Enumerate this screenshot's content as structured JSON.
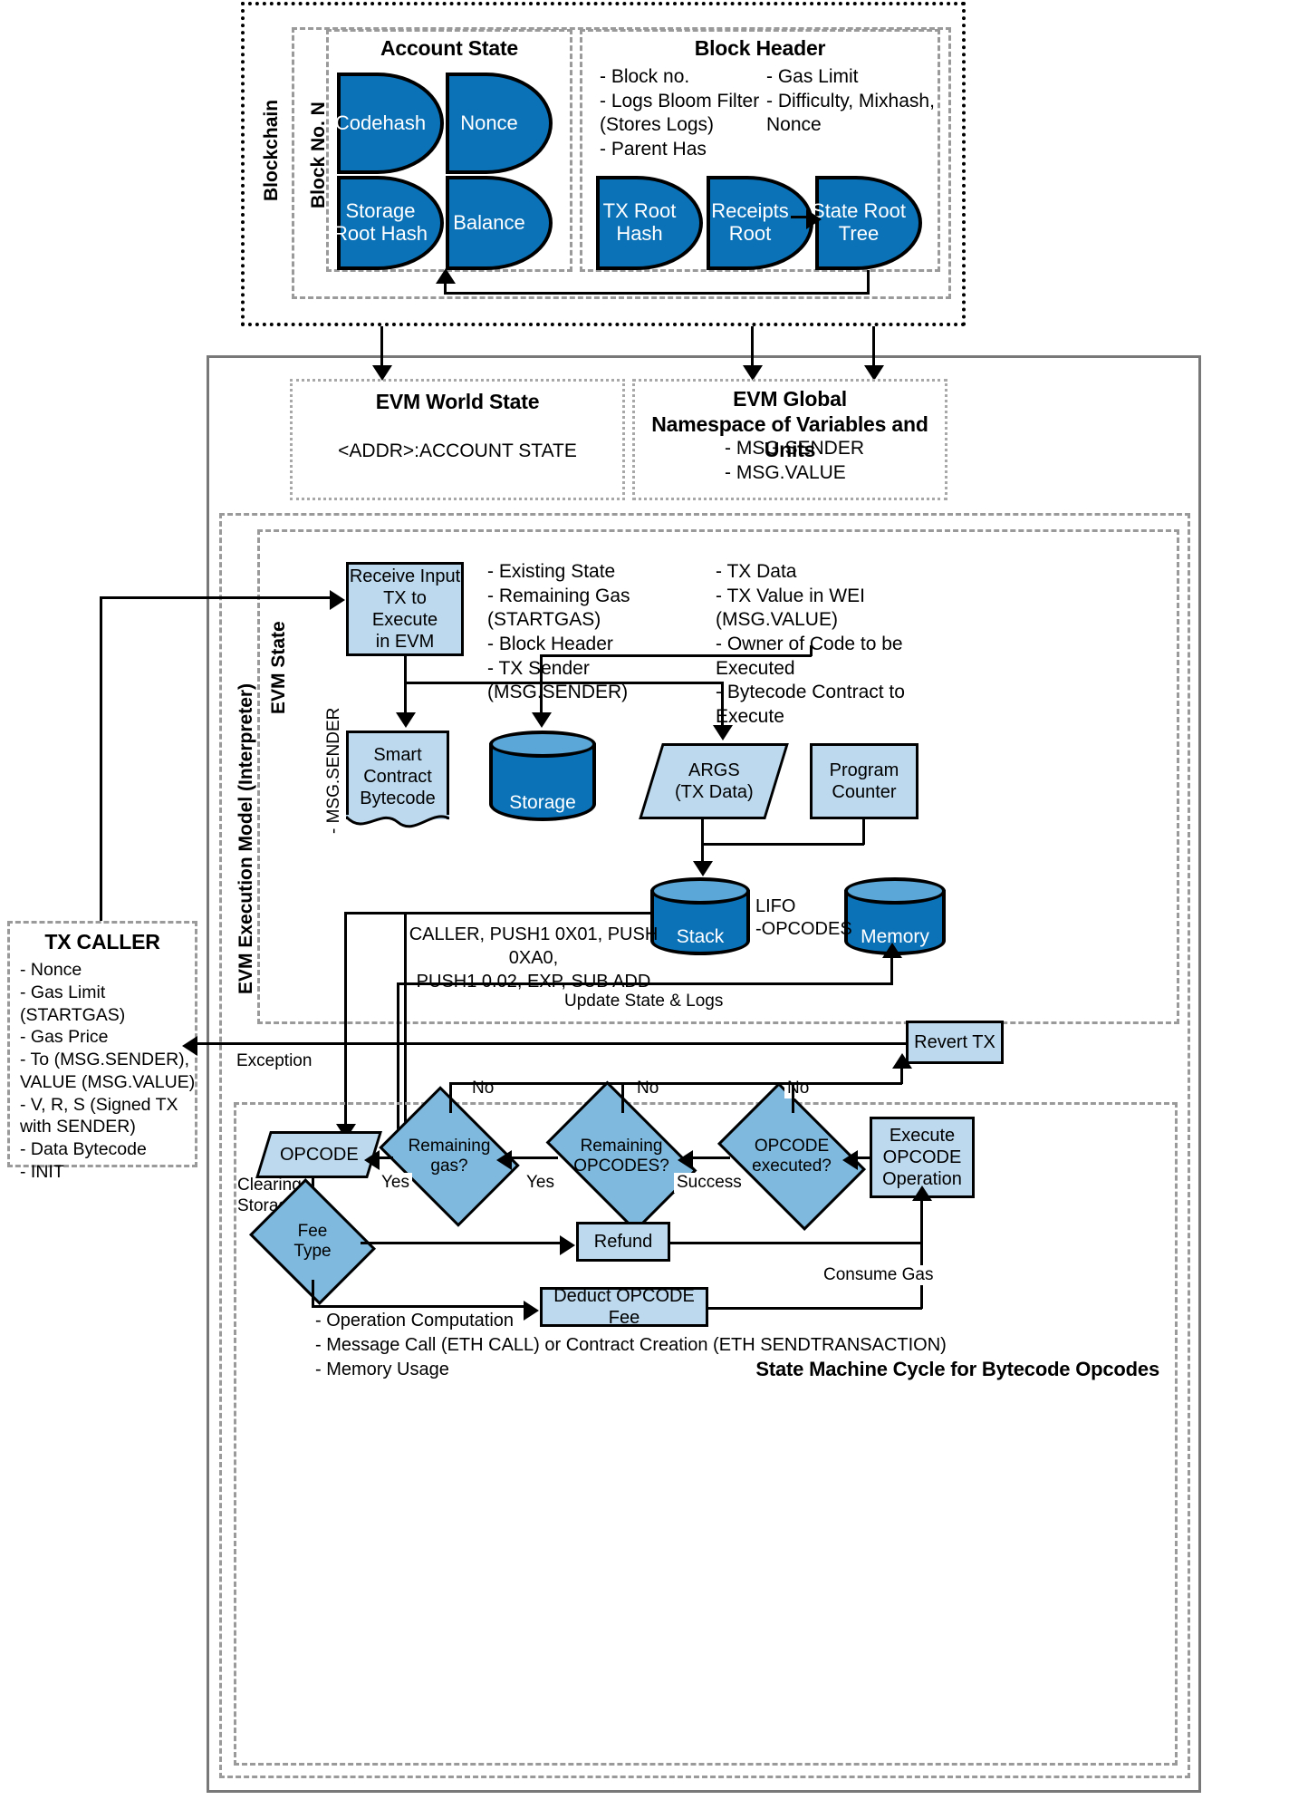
{
  "blockchain": {
    "label": "Blockchain",
    "block_label": "Block No. N",
    "account_state": {
      "title": "Account State",
      "fields": [
        "Codehash",
        "Nonce",
        "Storage\nRoot\nHash",
        "Balance"
      ]
    },
    "block_header": {
      "title": "Block Header",
      "left_items": "- Block no.\n- Logs Bloom Filter\n   (Stores Logs)\n- Parent Has",
      "right_items": "- Gas Limit\n- Difficulty, Mixhash,\n   Nonce",
      "roots": [
        "TX\nRoot\nHash",
        "Receipts\nRoot",
        "State\nRoot\nTree"
      ]
    }
  },
  "evm_world_state": {
    "title": "EVM World State",
    "content": "<ADDR>:ACCOUNT STATE"
  },
  "evm_global": {
    "title": "EVM Global\nNamespace of Variables and Units",
    "items": "- MSG.SENDER\n- MSG.VALUE"
  },
  "execution_model": {
    "label": "EVM Execution Model (Interpreter)",
    "state_label": "EVM State",
    "receive_input": "Receive Input\nTX to Execute\nin EVM",
    "inputs_left": "- Existing State\n- Remaining Gas (STARTGAS)\n- Block Header\n- TX Sender (MSG.SENDER)",
    "inputs_right": "- TX Data\n- TX Value in WEI (MSG.VALUE)\n- Owner of Code to be Executed\n- Bytecode Contract to Execute",
    "msg_sender_label": "- MSG.SENDER",
    "smart_contract": "Smart\nContract\nBytecode",
    "storage": "Storage",
    "args": "ARGS\n(TX Data)",
    "program_counter": "Program\nCounter",
    "stack": "Stack",
    "memory": "Memory",
    "lifo_note": "LIFO\n-OPCODES",
    "opcode_list": "CALLER, PUSH1 0X01, PUSH 0XA0,\nPUSH1 0.02, EXP, SUB ADD",
    "update_state_logs": "Update State & Logs"
  },
  "tx_caller": {
    "title": "TX CALLER",
    "items": "- Nonce\n- Gas Limit (STARTGAS)\n- Gas Price\n- To (MSG.SENDER),\n   VALUE (MSG.VALUE)\n- V, R, S (Signed TX\n   with SENDER)\n- Data Bytecode\n- INIT"
  },
  "state_machine": {
    "title": "State Machine Cycle for Bytecode Opcodes",
    "revert_tx": "Revert TX",
    "exception_label": "Exception",
    "opcode": "OPCODE",
    "clearing_storage": "Clearing\nStorage",
    "fee_type": "Fee\nType",
    "refund": "Refund",
    "deduct_fee": "Deduct OPCODE Fee",
    "consume_gas": "Consume Gas",
    "execute_opcode": "Execute\nOPCODE\nOperation",
    "decisions": [
      {
        "label": "Remaining\ngas?",
        "no": "No",
        "yes": "Yes"
      },
      {
        "label": "Remaining\nOPCODES?",
        "no": "No",
        "yes": "Yes"
      },
      {
        "label": "OPCODE\nexecuted?",
        "no": "No",
        "yes": "Success"
      }
    ],
    "footnotes": "- Operation Computation\n- Message Call (ETH CALL) or Contract Creation (ETH SENDTRANSACTION)\n- Memory Usage"
  },
  "colors": {
    "blue_fill": "#0c72b8",
    "light_blue": "#bcd9ee",
    "diamond_blue": "#7fb9dd",
    "cyl_top": "#5aa7d8",
    "grey_dash": "#9a9a9a"
  }
}
